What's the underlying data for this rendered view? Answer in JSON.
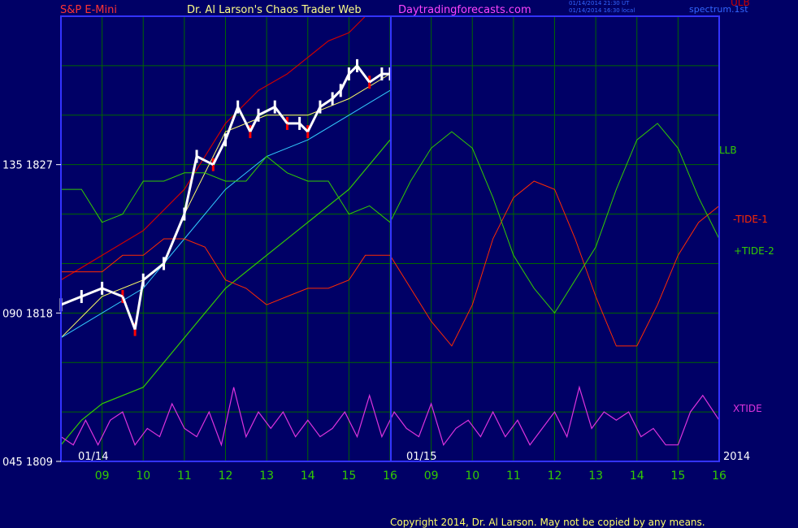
{
  "header": {
    "symbol": "S&P E-Mini",
    "title": "Dr. Al Larson's Chaos Trader Web",
    "site": "Daytradingforecasts.com",
    "stamp1": "01/14/2014 21:30 UT",
    "stamp2": "01/14/2014 16:30 local",
    "spectrum": "spectrum.1st"
  },
  "footer": {
    "copyright": "Copyright 2014, Dr. Al Larson. May not be copied by any means."
  },
  "colors": {
    "background": "#000066",
    "frame": "#3333ff",
    "grid": "#006600",
    "price_up": "#ffffff",
    "price_down": "#ff0000",
    "band": "#cc0000",
    "fast_avg": "#ffff66",
    "slow_avg": "#33ccff",
    "tide1": "#ff2a00",
    "tide2": "#33cc00",
    "xtide": "#dd33dd"
  },
  "chart_data": {
    "type": "line",
    "xlabel": "",
    "ylabel": "",
    "x_ticks": [
      "09",
      "10",
      "11",
      "12",
      "13",
      "14",
      "15",
      "16",
      "09",
      "10",
      "11",
      "12",
      "13",
      "14",
      "15",
      "16"
    ],
    "date_labels": [
      "01/14",
      "01/15"
    ],
    "year_label": "2014",
    "y_ticks": [
      {
        "label": "135  1827",
        "value": 1827
      },
      {
        "label": "090  1818",
        "value": 1818
      },
      {
        "label": "045  1809",
        "value": 1809
      }
    ],
    "y_range": [
      1809,
      1836
    ],
    "grid": true,
    "series_labels": {
      "ulb": "ULB",
      "llb": "LLB",
      "tide1": "-TIDE-1",
      "tide2": "+TIDE-2",
      "xtide": "XTIDE"
    },
    "price": {
      "name": "S&P E-Mini",
      "x": [
        8.0,
        8.5,
        9.0,
        9.5,
        9.8,
        10.0,
        10.5,
        11.0,
        11.3,
        11.7,
        12.0,
        12.3,
        12.6,
        12.8,
        13.2,
        13.5,
        13.8,
        14.0,
        14.3,
        14.6,
        14.8,
        15.0,
        15.2,
        15.5,
        15.8,
        16.0
      ],
      "y": [
        1818.5,
        1819.0,
        1819.5,
        1819.0,
        1817.0,
        1820.0,
        1821.0,
        1824.0,
        1827.5,
        1827.0,
        1828.5,
        1830.5,
        1829.0,
        1830.0,
        1830.5,
        1829.5,
        1829.5,
        1829.0,
        1830.5,
        1831.0,
        1831.5,
        1832.5,
        1833.0,
        1832.0,
        1832.5,
        1832.5
      ]
    },
    "series": [
      {
        "name": "ULB",
        "x": [
          8.0,
          9.0,
          10.0,
          11.0,
          12.0,
          12.8,
          13.5,
          14.0,
          14.5,
          15.0,
          15.4
        ],
        "y": [
          1820.0,
          1821.5,
          1823.0,
          1825.5,
          1829.5,
          1831.5,
          1832.5,
          1833.5,
          1834.5,
          1835.0,
          1836.0
        ]
      },
      {
        "name": "LLB",
        "x": [
          8.0,
          8.5,
          9.0,
          10.0,
          11.0,
          12.0,
          13.0,
          14.0,
          15.0,
          16.0
        ],
        "y": [
          1810.0,
          1811.5,
          1812.5,
          1813.5,
          1816.5,
          1819.5,
          1821.5,
          1823.5,
          1825.5,
          1828.5
        ]
      },
      {
        "name": "fast average",
        "x": [
          8.0,
          9.0,
          10.0,
          10.5,
          11.0,
          12.0,
          13.0,
          14.0,
          15.0,
          16.0
        ],
        "y": [
          1816.5,
          1819.0,
          1820.0,
          1821.0,
          1824.0,
          1829.0,
          1830.0,
          1830.0,
          1831.0,
          1832.5
        ]
      },
      {
        "name": "slow average",
        "x": [
          8.0,
          9.0,
          10.0,
          11.0,
          12.0,
          13.0,
          14.0,
          15.0,
          16.0
        ],
        "y": [
          1816.5,
          1818.0,
          1819.5,
          1822.5,
          1825.5,
          1827.5,
          1828.5,
          1830.0,
          1831.5
        ]
      },
      {
        "name": "-TIDE-1",
        "x": [
          8.0,
          9.0,
          9.5,
          10.0,
          10.5,
          11.0,
          11.5,
          12.0,
          12.5,
          13.0,
          13.5,
          14.0,
          14.5,
          15.0,
          15.4,
          16.0,
          16.5,
          17.0,
          17.5,
          18.0,
          18.5,
          19.0,
          19.5,
          20.0,
          20.5,
          21.0,
          21.5,
          22.0,
          22.5,
          23.0,
          23.5,
          24.0
        ],
        "y": [
          1820.5,
          1820.5,
          1821.5,
          1821.5,
          1822.5,
          1822.5,
          1822.0,
          1820.0,
          1819.5,
          1818.5,
          1819.0,
          1819.5,
          1819.5,
          1820.0,
          1821.5,
          1821.5,
          1819.5,
          1817.5,
          1816.0,
          1818.5,
          1822.5,
          1825.0,
          1826.0,
          1825.5,
          1822.5,
          1819.0,
          1816.0,
          1816.0,
          1818.5,
          1821.5,
          1823.5,
          1824.5
        ]
      },
      {
        "name": "+TIDE-2",
        "x": [
          8.0,
          8.5,
          9.0,
          9.5,
          10.0,
          10.5,
          11.0,
          11.5,
          12.0,
          12.5,
          13.0,
          13.5,
          14.0,
          14.5,
          15.0,
          15.5,
          16.0,
          16.5,
          17.0,
          17.5,
          18.0,
          18.5,
          19.0,
          19.5,
          20.0,
          20.5,
          21.0,
          21.5,
          22.0,
          22.5,
          23.0,
          23.5,
          24.0
        ],
        "y": [
          1825.5,
          1825.5,
          1823.5,
          1824.0,
          1826.0,
          1826.0,
          1826.5,
          1826.5,
          1826.0,
          1826.0,
          1827.5,
          1826.5,
          1826.0,
          1826.0,
          1824.0,
          1824.5,
          1823.5,
          1826.0,
          1828.0,
          1829.0,
          1828.0,
          1825.0,
          1821.5,
          1819.5,
          1818.0,
          1820.0,
          1822.0,
          1825.5,
          1828.5,
          1829.5,
          1828.0,
          1825.0,
          1822.5
        ]
      },
      {
        "name": "XTIDE",
        "x": [
          8.0,
          8.3,
          8.6,
          8.9,
          9.2,
          9.5,
          9.8,
          10.1,
          10.4,
          10.7,
          11.0,
          11.3,
          11.6,
          11.9,
          12.2,
          12.5,
          12.8,
          13.1,
          13.4,
          13.7,
          14.0,
          14.3,
          14.6,
          14.9,
          15.2,
          15.5,
          15.8,
          16.1,
          16.4,
          16.7,
          17.0,
          17.3,
          17.6,
          17.9,
          18.2,
          18.5,
          18.8,
          19.1,
          19.4,
          19.7,
          20.0,
          20.3,
          20.6,
          20.9,
          21.2,
          21.5,
          21.8,
          22.1,
          22.4,
          22.7,
          23.0,
          23.3,
          23.6,
          24.0
        ],
        "y": [
          1810.5,
          1810.0,
          1811.5,
          1810.0,
          1811.5,
          1812.0,
          1810.0,
          1811.0,
          1810.5,
          1812.5,
          1811.0,
          1810.5,
          1812.0,
          1810.0,
          1813.5,
          1810.5,
          1812.0,
          1811.0,
          1812.0,
          1810.5,
          1811.5,
          1810.5,
          1811.0,
          1812.0,
          1810.5,
          1813.0,
          1810.5,
          1812.0,
          1811.0,
          1810.5,
          1812.5,
          1810.0,
          1811.0,
          1811.5,
          1810.5,
          1812.0,
          1810.5,
          1811.5,
          1810.0,
          1811.0,
          1812.0,
          1810.5,
          1813.5,
          1811.0,
          1812.0,
          1811.5,
          1812.0,
          1810.5,
          1811.0,
          1810.0,
          1810.0,
          1812.0,
          1813.0,
          1811.5
        ]
      }
    ]
  }
}
